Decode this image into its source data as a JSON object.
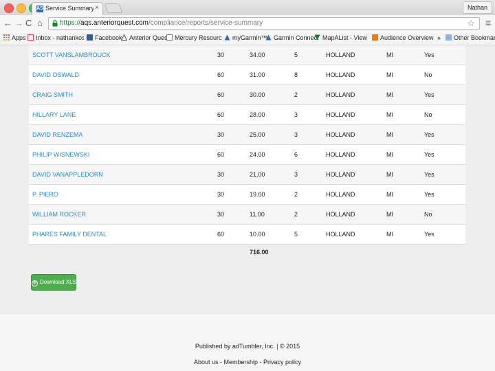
{
  "browser": {
    "tab_title": "Service Summary | Anterior",
    "tab_favicon": "AS",
    "tab_close": "×",
    "profile": "Nathan",
    "url_scheme": "https://",
    "url_host": "aqs.anteriorquest.com",
    "url_path": "/compliance/reports/service-summary",
    "star": "☆",
    "menu": "≡",
    "back": "←",
    "forward": "→",
    "reload": "C",
    "home": "⌂"
  },
  "bookmarks": {
    "apps": "Apps",
    "inbox": "Inbox - nathankoster",
    "facebook": "Facebook",
    "anterior": "Anterior Quest",
    "mercury": "Mercury Resource Lo",
    "mygarmin": "myGarmin™",
    "garmin_connect": "Garmin Connect",
    "maplist": "MapAList - View Ma",
    "audience": "Audience Overview",
    "overflow": "»",
    "other": "Other Bookmarks"
  },
  "rows": [
    {
      "name": "SCOTT VANSLAMBROUCK",
      "a": "30",
      "b": "34.00",
      "c": "5",
      "city": "HOLLAND",
      "state": "MI",
      "flag": "Yes"
    },
    {
      "name": "DAVID OSWALD",
      "a": "60",
      "b": "31.00",
      "c": "8",
      "city": "HOLLAND",
      "state": "MI",
      "flag": "No"
    },
    {
      "name": "CRAIG SMITH",
      "a": "60",
      "b": "30.00",
      "c": "2",
      "city": "HOLLAND",
      "state": "MI",
      "flag": "Yes"
    },
    {
      "name": "HILLARY LANE",
      "a": "60",
      "b": "28.00",
      "c": "3",
      "city": "HOLLAND",
      "state": "MI",
      "flag": "No"
    },
    {
      "name": "DAVID RENZEMA",
      "a": "30",
      "b": "25.00",
      "c": "3",
      "city": "HOLLAND",
      "state": "MI",
      "flag": "Yes"
    },
    {
      "name": "PHILIP WISNEWSKI",
      "a": "60",
      "b": "24.00",
      "c": "6",
      "city": "HOLLAND",
      "state": "MI",
      "flag": "Yes"
    },
    {
      "name": "DAVID VANAPPLEDORN",
      "a": "30",
      "b": "21.00",
      "c": "3",
      "city": "HOLLAND",
      "state": "MI",
      "flag": "Yes"
    },
    {
      "name": "P. PIERO",
      "a": "30",
      "b": "19.00",
      "c": "2",
      "city": "HOLLAND",
      "state": "MI",
      "flag": "Yes"
    },
    {
      "name": "WILLIAM ROCKER",
      "a": "30",
      "b": "11.00",
      "c": "2",
      "city": "HOLLAND",
      "state": "MI",
      "flag": "No"
    },
    {
      "name": "PHARES FAMILY DENTAL",
      "a": "60",
      "b": "10.00",
      "c": "5",
      "city": "HOLLAND",
      "state": "MI",
      "flag": "Yes"
    }
  ],
  "total": "716.00",
  "download_button": "Download XLS",
  "download_icon": "⊕",
  "footer": {
    "published": "Published by adTumbler, Inc. | © 2015",
    "about": "About us",
    "sep1": " - ",
    "membership": "Membership",
    "sep2": " - ",
    "privacy": "Privacy policy"
  }
}
